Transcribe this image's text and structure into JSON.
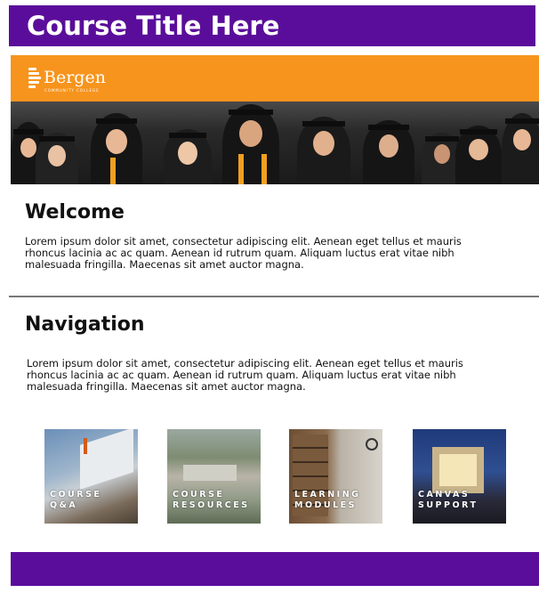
{
  "header": {
    "title": "Course Title Here"
  },
  "banner": {
    "logo_text": "Bergen",
    "logo_subtext": "COMMUNITY COLLEGE"
  },
  "welcome": {
    "heading": "Welcome",
    "line1": "Lorem ipsum dolor sit amet, consectetur adipiscing elit. Aenean eget tellus et mauris",
    "line2": "rhoncus lacinia ac ac quam. Aenean id rutrum quam. Aliquam luctus erat vitae nibh",
    "line3": "malesuada fringilla. Maecenas sit amet auctor magna."
  },
  "navigation": {
    "heading": "Navigation",
    "line1": "Lorem ipsum dolor sit amet, consectetur adipiscing elit. Aenean eget tellus et mauris",
    "line2": "rhoncus lacinia ac ac quam. Aenean id rutrum quam. Aliquam luctus erat vitae nibh",
    "line3": "malesuada fringilla. Maecenas sit amet auctor magna.",
    "tiles": [
      {
        "line1": "COURSE",
        "line2": "Q&A"
      },
      {
        "line1": "COURSE",
        "line2": "RESOURCES"
      },
      {
        "line1": "LEARNING",
        "line2": "MODULES"
      },
      {
        "line1": "CANVAS",
        "line2": "SUPPORT"
      }
    ]
  },
  "colors": {
    "brand_purple": "#5a0d9a",
    "banner_orange": "#f7941d",
    "divider": "#777777"
  }
}
